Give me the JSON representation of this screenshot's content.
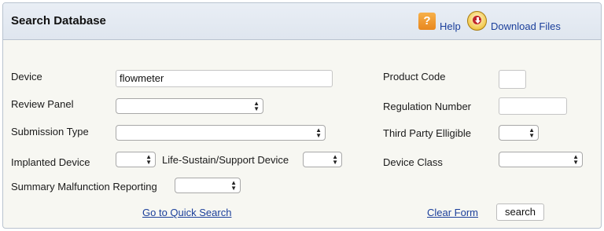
{
  "header": {
    "title": "Search Database",
    "help_label": "Help",
    "download_label": "Download Files"
  },
  "form": {
    "device": {
      "label": "Device",
      "value": "flowmeter"
    },
    "review_panel": {
      "label": "Review Panel",
      "value": ""
    },
    "submission_type": {
      "label": "Submission Type",
      "value": ""
    },
    "implanted_device": {
      "label": "Implanted Device",
      "value": ""
    },
    "life_sustain": {
      "label": "Life-Sustain/Support Device",
      "value": ""
    },
    "summary_malfunction": {
      "label": "Summary Malfunction Reporting",
      "value": ""
    },
    "product_code": {
      "label": "Product Code",
      "value": ""
    },
    "regulation_number": {
      "label": "Regulation Number",
      "value": ""
    },
    "third_party": {
      "label": "Third Party Elligible",
      "value": ""
    },
    "device_class": {
      "label": "Device Class",
      "value": ""
    }
  },
  "footer": {
    "quick_search_label": "Go to Quick Search",
    "clear_form_label": "Clear Form",
    "search_label": "search"
  },
  "colors": {
    "link": "#1b3f9b",
    "header_bg": "#e3e9f1",
    "panel_bg": "#f7f7f2",
    "help_icon": "#ef9a2c"
  },
  "icons": [
    "help-icon",
    "download-icon",
    "select-arrows-icon"
  ]
}
